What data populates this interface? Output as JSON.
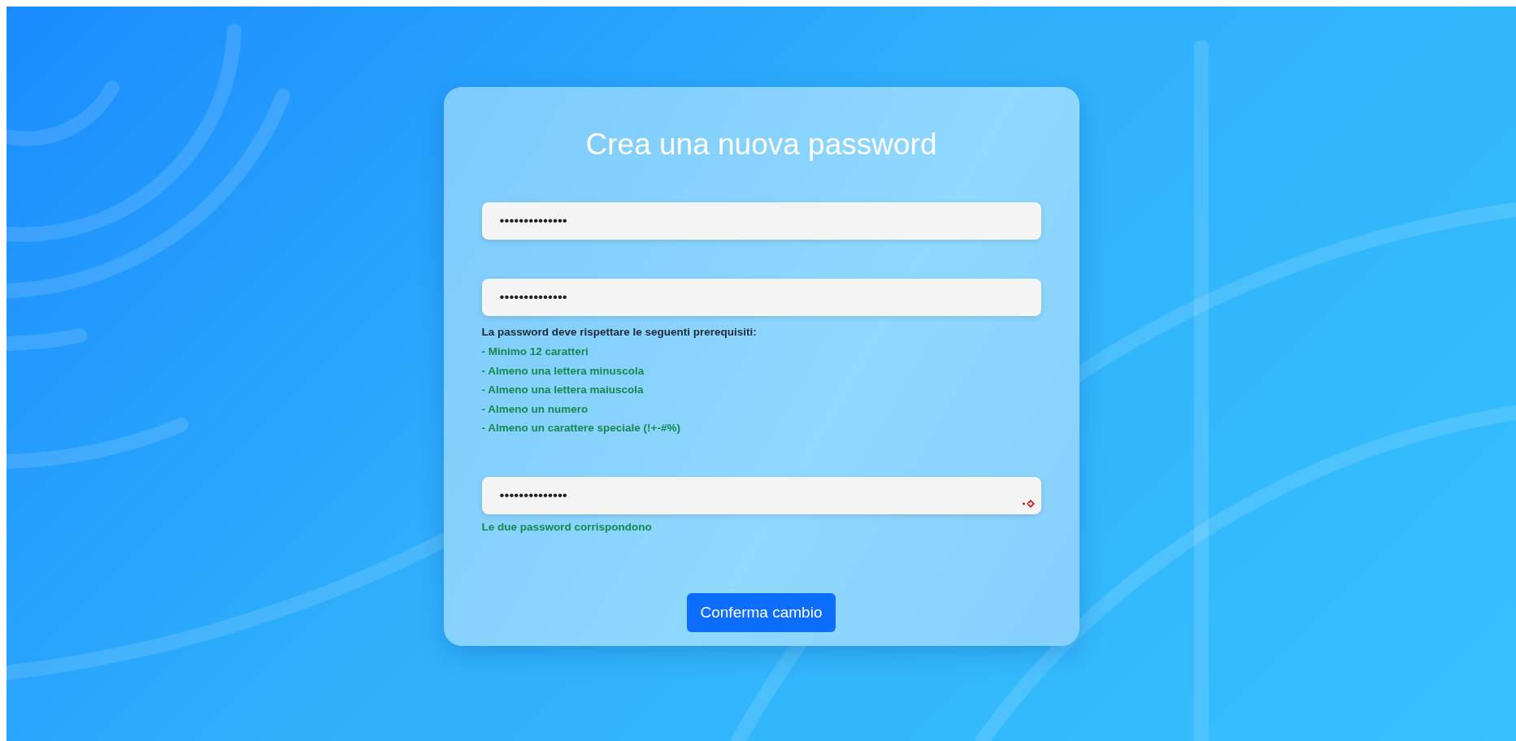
{
  "card": {
    "title": "Crea una nuova password",
    "fields": [
      {
        "kind": "plain",
        "value": "••••••••••••••"
      },
      {
        "kind": "plain",
        "value": "••••••••••••••"
      },
      {
        "kind": "with-icon",
        "value": "••••••••••••••"
      }
    ],
    "requirements": {
      "heading": "La password deve rispettare le seguenti prerequisiti:",
      "items": [
        {
          "text": "- Minimo 12 caratteri",
          "met": true
        },
        {
          "text": "- Almeno una lettera minuscola",
          "met": true
        },
        {
          "text": "- Almeno una lettera maiuscola",
          "met": true
        },
        {
          "text": "- Almeno un numero",
          "met": true
        },
        {
          "text": "- Almeno un carattere speciale (!+-#%)",
          "met": true
        }
      ]
    },
    "match_message": {
      "text": "Le due password corrispondono",
      "met": true
    },
    "button": "Conferma cambio"
  }
}
